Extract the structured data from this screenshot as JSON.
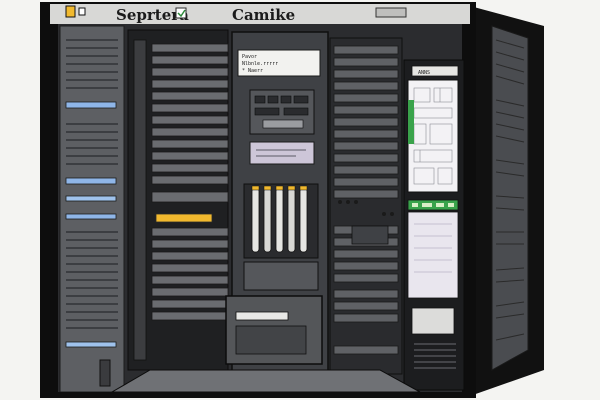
{
  "header": {
    "left_title": "Seprtera",
    "right_title": "Camike"
  },
  "panel_note": {
    "line1": "Pavor",
    "line2": "Nlbnle.rrrrr",
    "line3": "* Naerr"
  },
  "side_display": {
    "header_text": "ANNS"
  },
  "colors": {
    "frame": "#0d0d0d",
    "metal": "#6f7175",
    "metal_dark": "#3f4145",
    "accent_yellow": "#f1b92e",
    "screen_bg": "#e9e6ee",
    "screen_green": "#3aa34b"
  },
  "icons": {
    "logo": "yellow-square-icon",
    "checkbox": "checkbox-icon",
    "panel_icon": "grid-icon"
  }
}
